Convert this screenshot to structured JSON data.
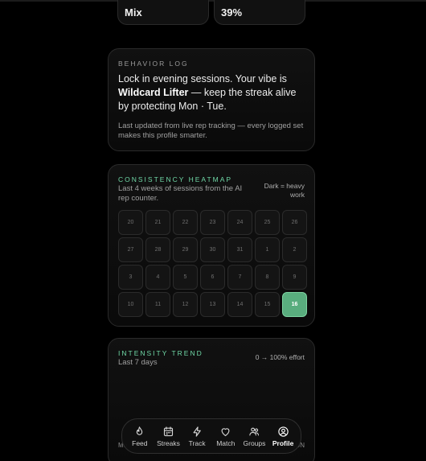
{
  "stats": [
    {
      "value": "Mix"
    },
    {
      "value": "39%"
    }
  ],
  "behavior_log": {
    "eyebrow": "BEHAVIOR LOG",
    "headline_pre": "Lock in evening sessions. Your vibe is ",
    "headline_bold": "Wildcard Lifter",
    "headline_post": " — keep the streak alive by protecting Mon · Tue.",
    "note": "Last updated from live rep tracking — every logged set makes this profile smarter."
  },
  "heatmap": {
    "eyebrow": "CONSISTENCY HEATMAP",
    "subtitle": "Last 4 weeks of sessions from the AI rep counter.",
    "legend": "Dark = heavy work",
    "days": [
      {
        "label": "20",
        "active": false
      },
      {
        "label": "21",
        "active": false
      },
      {
        "label": "22",
        "active": false
      },
      {
        "label": "23",
        "active": false
      },
      {
        "label": "24",
        "active": false
      },
      {
        "label": "25",
        "active": false
      },
      {
        "label": "26",
        "active": false
      },
      {
        "label": "27",
        "active": false
      },
      {
        "label": "28",
        "active": false
      },
      {
        "label": "29",
        "active": false
      },
      {
        "label": "30",
        "active": false
      },
      {
        "label": "31",
        "active": false
      },
      {
        "label": "1",
        "active": false
      },
      {
        "label": "2",
        "active": false
      },
      {
        "label": "3",
        "active": false
      },
      {
        "label": "4",
        "active": false
      },
      {
        "label": "5",
        "active": false
      },
      {
        "label": "6",
        "active": false
      },
      {
        "label": "7",
        "active": false
      },
      {
        "label": "8",
        "active": false
      },
      {
        "label": "9",
        "active": false
      },
      {
        "label": "10",
        "active": false
      },
      {
        "label": "11",
        "active": false
      },
      {
        "label": "12",
        "active": false
      },
      {
        "label": "13",
        "active": false
      },
      {
        "label": "14",
        "active": false
      },
      {
        "label": "15",
        "active": false
      },
      {
        "label": "16",
        "active": true
      }
    ]
  },
  "trend": {
    "eyebrow": "INTENSITY TREND",
    "subtitle": "Last 7 days",
    "range": "0 → 100% effort",
    "x_start": "Mo",
    "x_end": "SUN"
  },
  "nav": {
    "items": [
      {
        "label": "Feed",
        "icon": "flame-icon",
        "active": false
      },
      {
        "label": "Streaks",
        "icon": "calendar-icon",
        "active": false
      },
      {
        "label": "Track",
        "icon": "bolt-icon",
        "active": false
      },
      {
        "label": "Match",
        "icon": "heart-icon",
        "active": false
      },
      {
        "label": "Groups",
        "icon": "users-icon",
        "active": false
      },
      {
        "label": "Profile",
        "icon": "user-circle-icon",
        "active": true
      }
    ]
  },
  "colors": {
    "accent": "#6fd7a6",
    "active_cell": "#59ad7e",
    "background": "#000000"
  }
}
